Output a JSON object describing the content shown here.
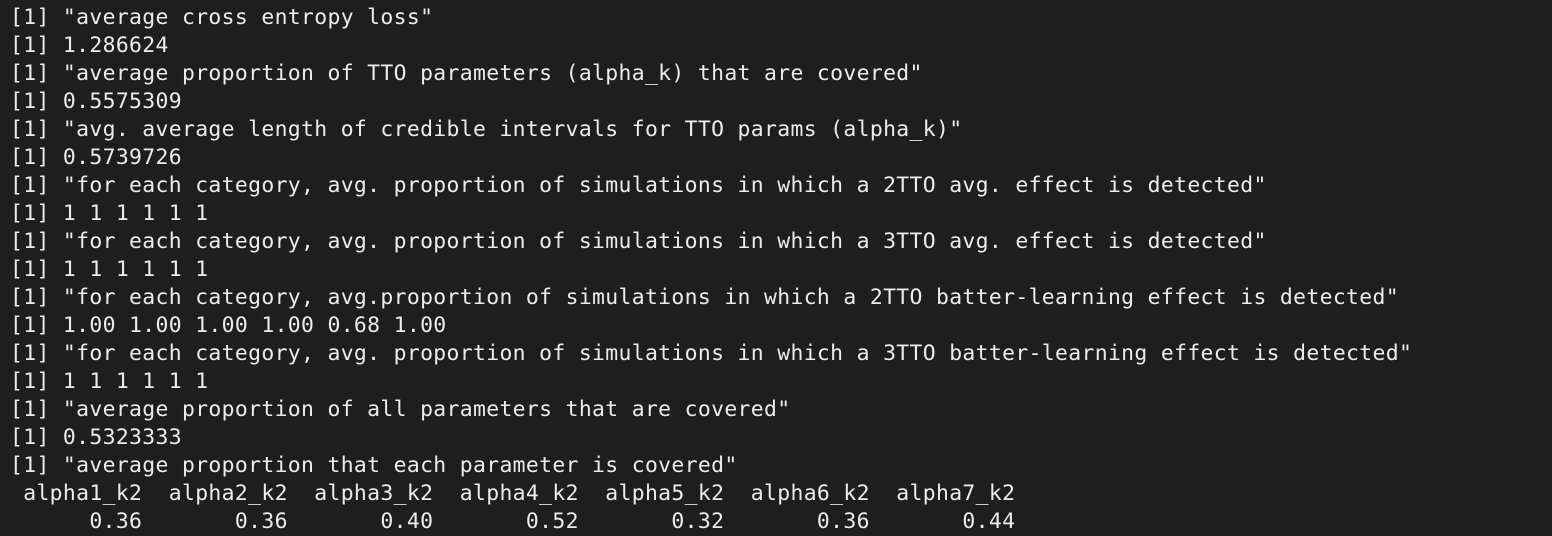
{
  "terminal": {
    "lines": [
      "[1] \"average cross entropy loss\"",
      "[1] 1.286624",
      "[1] \"average proportion of TTO parameters (alpha_k) that are covered\"",
      "[1] 0.5575309",
      "[1] \"avg. average length of credible intervals for TTO params (alpha_k)\"",
      "[1] 0.5739726",
      "[1] \"for each category, avg. proportion of simulations in which a 2TTO avg. effect is detected\"",
      "[1] 1 1 1 1 1 1",
      "[1] \"for each category, avg. proportion of simulations in which a 3TTO avg. effect is detected\"",
      "[1] 1 1 1 1 1 1",
      "[1] \"for each category, avg.proportion of simulations in which a 2TTO batter-learning effect is detected\"",
      "[1] 1.00 1.00 1.00 1.00 0.68 1.00",
      "[1] \"for each category, avg. proportion of simulations in which a 3TTO batter-learning effect is detected\"",
      "[1] 1 1 1 1 1 1",
      "[1] \"average proportion of all parameters that are covered\"",
      "[1] 0.5323333",
      "[1] \"average proportion that each parameter is covered\""
    ],
    "named_vector": {
      "names_line": " alpha1_k2  alpha2_k2  alpha3_k2  alpha4_k2  alpha5_k2  alpha6_k2  alpha7_k2",
      "values_line": "      0.36       0.36       0.40       0.52       0.32       0.36       0.44"
    }
  }
}
